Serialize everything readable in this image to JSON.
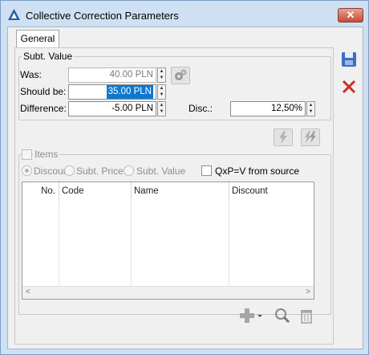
{
  "window": {
    "title": "Collective Correction Parameters",
    "close_label": "✕"
  },
  "tabs": [
    {
      "label": "General"
    }
  ],
  "subt_value": {
    "title": "Subt. Value",
    "was_label": "Was:",
    "was_value": "40.00 PLN",
    "should_be_label": "Should be:",
    "should_be_value": "35.00 PLN",
    "difference_label": "Difference:",
    "difference_value": "-5.00 PLN",
    "disc_label": "Disc.:",
    "disc_value": "12,50%"
  },
  "items": {
    "title": "Items",
    "radio_discount": "Discoun",
    "radio_subt_price": "Subt. Price",
    "radio_subt_value": "Subt. Value",
    "qxp_label": "QxP=V from source",
    "columns": [
      "No.",
      "Code",
      "Name",
      "Discount"
    ],
    "scroll_left": "<",
    "scroll_right": ">"
  },
  "icons": {
    "app": "app-logo-icon",
    "save": "save-icon",
    "cancel": "cancel-x-icon",
    "gear": "gear-icon",
    "lightning1": "lightning-icon",
    "lightning2": "lightning-double-icon",
    "add": "plus-icon",
    "search": "magnifier-icon",
    "delete": "trash-icon"
  }
}
